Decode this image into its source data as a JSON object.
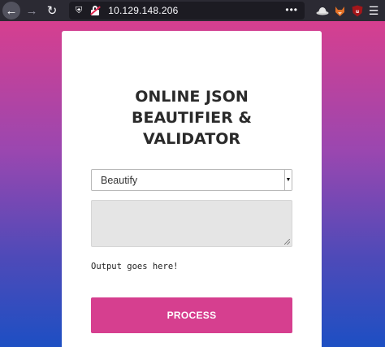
{
  "browser": {
    "url": "10.129.148.206",
    "overflow_menu": "•••"
  },
  "page": {
    "title_lines": [
      "ONLINE JSON",
      "BEAUTIFIER &",
      "VALIDATOR"
    ],
    "mode_select": {
      "selected": "Beautify"
    },
    "input": {
      "value": ""
    },
    "output_text": "Output goes here!",
    "process_button": "PROCESS"
  },
  "icons": {
    "back": "back-arrow-icon",
    "forward": "forward-arrow-icon",
    "reload": "reload-icon",
    "tracking": "shield-icon",
    "insecure": "insecure-lock-icon",
    "ext1": "hat-icon",
    "ext2": "fox-icon",
    "ext3": "ublock-icon",
    "menu": "hamburger-menu-icon"
  },
  "colors": {
    "accent": "#d63f8f",
    "gradient_top": "#d63f8f",
    "gradient_bottom": "#1d4fc3"
  }
}
